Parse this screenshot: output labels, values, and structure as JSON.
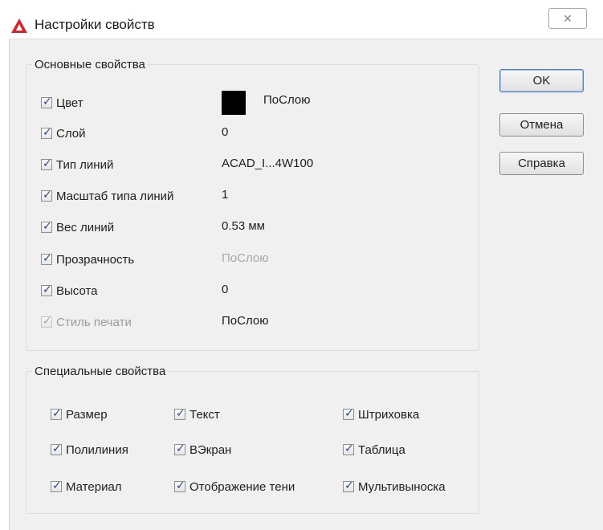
{
  "window": {
    "title": "Настройки свойств",
    "close_glyph": "✕"
  },
  "basic": {
    "legend": "Основные свойства",
    "items": [
      {
        "label": "Цвет",
        "value": "ПоСлою",
        "swatch": "#000000"
      },
      {
        "label": "Слой",
        "value": "0"
      },
      {
        "label": "Тип линий",
        "value": "ACAD_I...4W100"
      },
      {
        "label": "Масштаб типа линий",
        "value": "1"
      },
      {
        "label": "Вес линий",
        "value": "0.53 мм"
      },
      {
        "label": "Прозрачность",
        "value": "ПоСлою"
      },
      {
        "label": "Высота",
        "value": "0"
      },
      {
        "label": "Стиль печати",
        "value": "ПоСлою"
      }
    ]
  },
  "special": {
    "legend": "Специальные свойства",
    "items": [
      "Размер",
      "Текст",
      "Штриховка",
      "Полилиния",
      "ВЭкран",
      "Таблица",
      "Материал",
      "Отображение тени",
      "Мультивыноска"
    ]
  },
  "buttons": {
    "ok": "OK",
    "cancel": "Отмена",
    "help": "Справка"
  },
  "colors": {
    "accent_default_button": "#4e7fbf",
    "app_icon": "#d8242a"
  }
}
